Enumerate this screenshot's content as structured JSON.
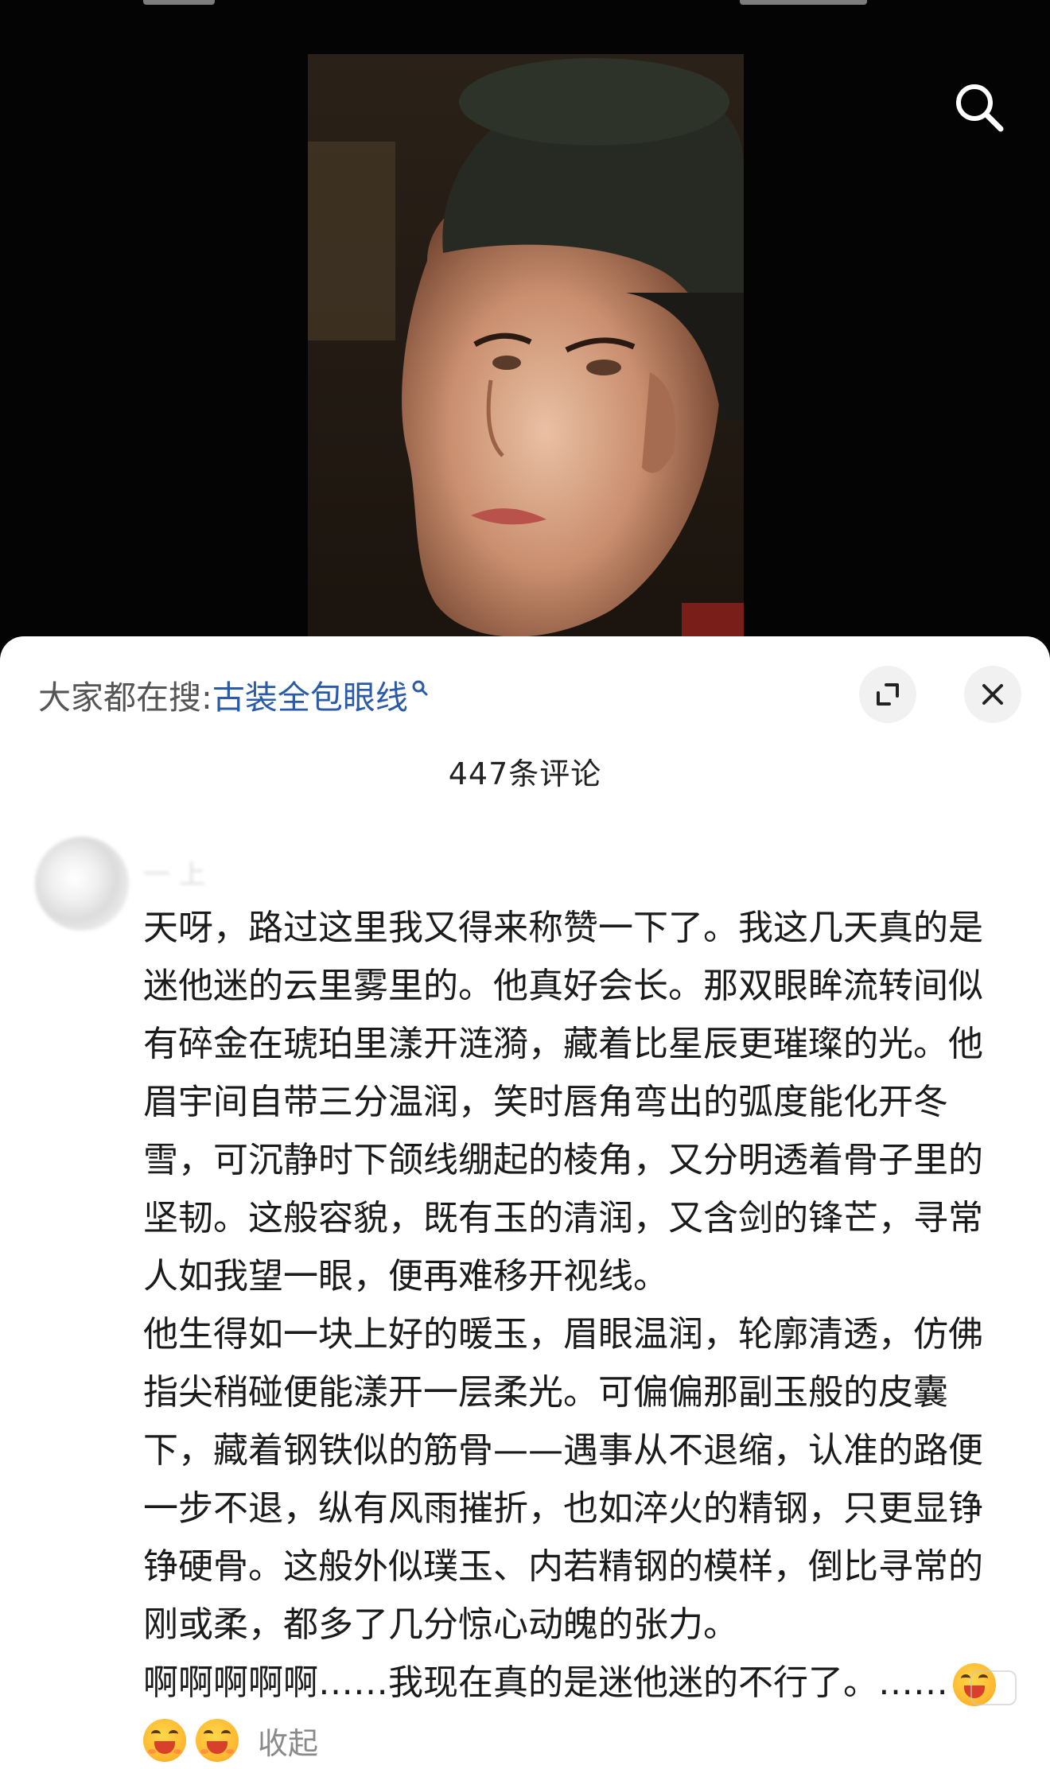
{
  "hot_search": {
    "prefix": "大家都在搜:",
    "term": "古装全包眼线"
  },
  "icons": {
    "search": "search-icon",
    "expand": "expand-icon",
    "close": "close-icon",
    "inline_search": "search-icon",
    "emoji": "grinning-emoji-icon"
  },
  "comments_header": {
    "count_label": "447条评论"
  },
  "comment": {
    "username": "一 上",
    "paragraphs": [
      "天呀，路过这里我又得来称赞一下了。我这几天真的是迷他迷的云里雾里的。他真好会长。那双眼眸流转间似有碎金在琥珀里漾开涟漪，藏着比星辰更璀璨的光。他眉宇间自带三分温润，笑时唇角弯出的弧度能化开冬雪，可沉静时下颌线绷起的棱角，又分明透着骨子里的坚韧。这般容貌，既有玉的清润，又含剑的锋芒，寻常人如我望一眼，便再难移开视线。",
      "他生得如一块上好的暖玉，眉眼温润，轮廓清透，仿佛指尖稍碰便能漾开一层柔光。可偏偏那副玉般的皮囊下，藏着钢铁似的筋骨——遇事从不退缩，认准的路便一步不退，纵有风雨摧折，也如淬火的精钢，只更显铮铮硬骨。这般外似璞玉、内若精钢的模样，倒比寻常的刚或柔，都多了几分惊心动魄的张力。",
      "啊啊啊啊啊……我现在真的是迷他迷的不行了。……"
    ],
    "collapse_label": "收起"
  },
  "colors": {
    "link_blue": "#2a5aa8",
    "sheet_bg": "#ffffff",
    "video_bg": "#040404",
    "muted_text": "#8a8a8a"
  }
}
